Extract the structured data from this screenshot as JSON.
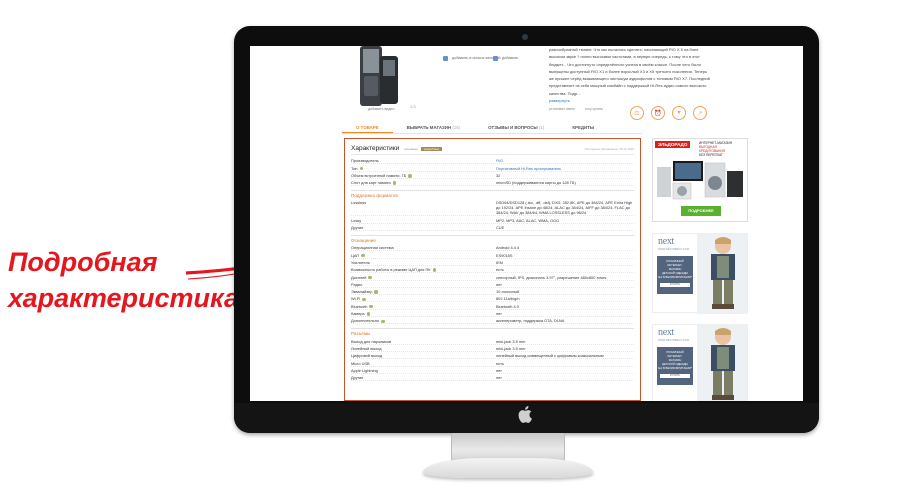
{
  "callout": {
    "line1": "Подробная",
    "line2": "характеристика",
    "color": "#e5161d"
  },
  "product": {
    "image_caption": "добавить видео",
    "zoom_label": "1:3",
    "actions": [
      {
        "label": "добавить в список желаний",
        "icon": "heart-list-icon"
      },
      {
        "label": "добавить",
        "icon": "plus-icon"
      }
    ],
    "description": "разнообразный тюнинг. Что мы пытались сделать: начинающий PIO X 5 на боее высоком звуке ? полно высокими частотами, в первую очередь, к тому что в этот бюджет... Что достигнуто определённого успеха в своём классе. После чего было выпущены доступный FiiO X1 и более взрослый X3 и X5 третьего поколения. Теперь же пришел черёд вызывающего чистошум аудиофилов с топовым FiiO X7. Последний представляет из себя мощный комбайн с поддержкой Hi-Res аудио самого высокого качества. Подр...",
    "more_label": "развернуть",
    "likes": [
      "установил имею",
      "хочу купить"
    ],
    "round_buttons": [
      "compare-icon",
      "alert-icon",
      "favorite-icon",
      "share-icon"
    ]
  },
  "tabs": [
    {
      "label": "О ТОВАРЕ",
      "count": "",
      "active": true
    },
    {
      "label": "ВЫБРАТЬ МАГАЗИН",
      "count": "(16)",
      "active": false
    },
    {
      "label": "ОТЗЫВЫ И ВОПРОСЫ",
      "count": "(1)",
      "active": false
    },
    {
      "label": "КРЕДИТЫ",
      "count": "",
      "active": false
    }
  ],
  "specs": {
    "title": "Характеристики",
    "tag1": "основные",
    "tag2": "подробные",
    "updated": "Последнее обновление: 06.11.2016",
    "groups": [
      {
        "header": "",
        "rows": [
          {
            "k": "Производитель",
            "v": "FiiO",
            "link": true
          },
          {
            "k": "Тип",
            "v": "Портативный Hi-Res проигрыватель",
            "link": true,
            "q": true
          },
          {
            "k": "Объем встроенной памяти, ГБ",
            "v": "32",
            "q": true
          },
          {
            "k": "Слот для карт памяти",
            "v": "microSD (поддерживаются карты до 128 ГБ)",
            "q": true
          }
        ]
      },
      {
        "header": "Поддержка форматов",
        "rows": [
          {
            "k": "Lossless",
            "v": "DSD64/DSD128 (.iso, .dff, .dsf), DXD, 352.8K, APE до 384/24, APE Extra High до 192/24, APE Insane до 48/24, ALAC до 384/24, AIFF до 384/24, FLAC до 384/24, WAV до 384/64, WMA LOSSLESS до 96/24"
          },
          {
            "k": "Lossy",
            "v": "MP2, MP3, AAC, ALAC, WMA, OGG"
          },
          {
            "k": "Другие",
            "v": "CUE"
          }
        ]
      },
      {
        "header": "Оснащение",
        "rows": [
          {
            "k": "Операционная система",
            "v": "Android 4.4.4"
          },
          {
            "k": "ЦАП",
            "v": "ES9018S",
            "q": true
          },
          {
            "k": "Усилитель",
            "v": "IEM"
          },
          {
            "k": "Возможность работы в режиме ЦАП для ПК",
            "v": "есть",
            "q": true
          },
          {
            "k": "Дисплей",
            "v": "сенсорный, IPS, диагональ 3.97\", разрешение 480x800 точек",
            "q": true
          },
          {
            "k": "Радио",
            "v": "нет"
          },
          {
            "k": "Эквалайзер",
            "v": "10-полосный",
            "q": true
          },
          {
            "k": "Wi-Fi",
            "v": "802.11a/b/g/n",
            "q": true
          },
          {
            "k": "Bluetooth",
            "v": "Bluetooth 4.0",
            "q": true
          },
          {
            "k": "Камера",
            "v": "нет",
            "q": true
          },
          {
            "k": "Дополнительно",
            "v": "акселерометр, поддержка OTA, DLNA",
            "q": true
          }
        ]
      },
      {
        "header": "Разъемы",
        "rows": [
          {
            "k": "Выход для наушников",
            "v": "mini-jack 3.5 mm"
          },
          {
            "k": "Линейный выход",
            "v": "mini-jack 3.5 mm"
          },
          {
            "k": "Цифровой выход",
            "v": "линейный выход совмещенный с цифровым коаксиальным"
          },
          {
            "k": "Micro USB",
            "v": "есть"
          },
          {
            "k": "Apple Lightning",
            "v": "нет"
          },
          {
            "k": "Другие",
            "v": "нет"
          }
        ]
      }
    ]
  },
  "banners": {
    "eldorado": {
      "logo": "ЭЛЬДОРАДО",
      "line1": "ИНТЕРНЕТ-МАГАЗИН",
      "line2": "ВЫГОДНАЯ",
      "line3": "КРЕДИТОВАНИЯ",
      "line4": "БЕЗ ПЕРЕПЛАТ",
      "button": "ПОДРОБНЕЕ"
    },
    "next": [
      {
        "brand": "next",
        "sub": "WWW.NEXTDIRECT.COM",
        "l1": "РОЗНИЧНЫЙ",
        "l2": "ИНТЕРНЕТ-",
        "l3": "МАГАЗИН",
        "l4": "ДЕТСКОЙ ОДЕЖДЫ",
        "l5": "№1 В ВЕЛИКОБРИТАНИИ*",
        "btn": "КУПИТЬ"
      },
      {
        "brand": "next",
        "sub": "WWW.NEXTDIRECT.COM",
        "l1": "РОЗНИЧНЫЙ",
        "l2": "ИНТЕРНЕТ-",
        "l3": "МАГАЗИН",
        "l4": "ДЕТСКОЙ ОДЕЖДЫ",
        "l5": "№1 В ВЕЛИКОБРИТАНИИ*",
        "btn": "КУПИТЬ"
      }
    ]
  }
}
